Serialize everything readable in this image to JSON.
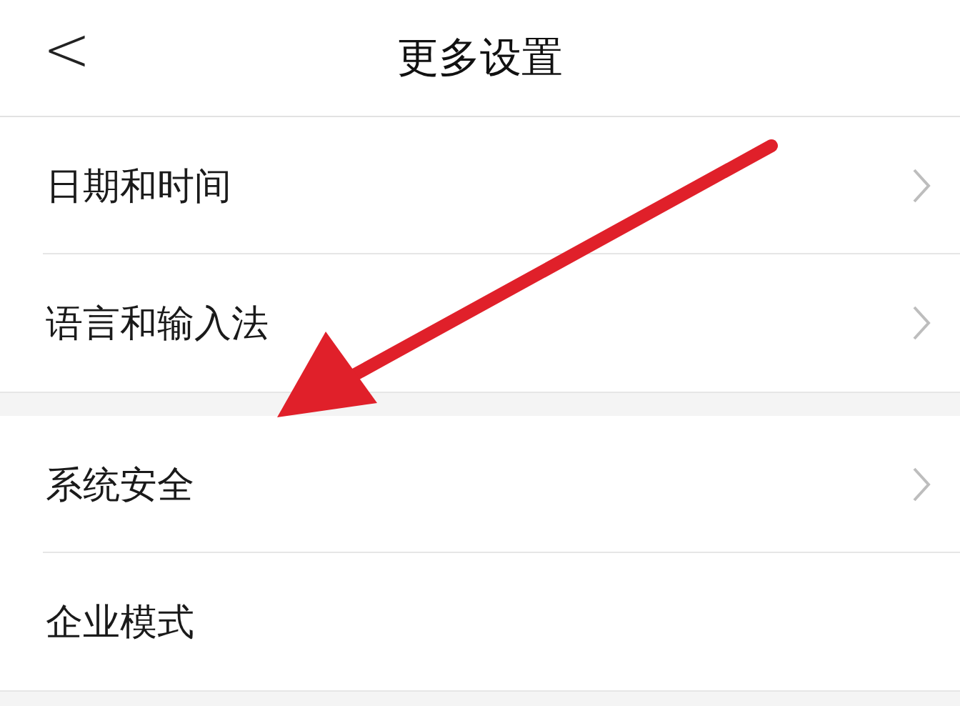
{
  "header": {
    "back": "<",
    "title": "更多设置"
  },
  "sections": [
    {
      "rows": [
        {
          "label": "日期和时间",
          "chevron": true
        },
        {
          "label": "语言和输入法",
          "chevron": true
        }
      ]
    },
    {
      "rows": [
        {
          "label": "系统安全",
          "chevron": true
        },
        {
          "label": "企业模式",
          "chevron": false
        }
      ]
    }
  ],
  "annotations": [
    {
      "kind": "arrow",
      "color": "#e0202a"
    }
  ]
}
